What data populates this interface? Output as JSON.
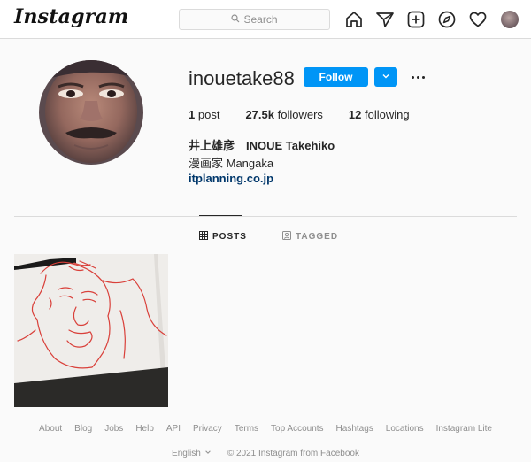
{
  "header": {
    "logo": "Instagram",
    "search_placeholder": "Search"
  },
  "profile": {
    "username": "inouetake88",
    "follow_label": "Follow",
    "stats": [
      {
        "value": "1",
        "label": "post"
      },
      {
        "value": "27.5k",
        "label": "followers"
      },
      {
        "value": "12",
        "label": "following"
      }
    ],
    "full_name": "井上雄彦　INOUE Takehiko",
    "bio": "漫画家 Mangaka",
    "link": "itplanning.co.jp"
  },
  "tabs": [
    {
      "label": "POSTS",
      "active": true
    },
    {
      "label": "TAGGED",
      "active": false
    }
  ],
  "footer": {
    "links": [
      "About",
      "Blog",
      "Jobs",
      "Help",
      "API",
      "Privacy",
      "Terms",
      "Top Accounts",
      "Hashtags",
      "Locations",
      "Instagram Lite"
    ],
    "language": "English",
    "copyright": "© 2021 Instagram from Facebook"
  },
  "colors": {
    "accent": "#0095f6",
    "link": "#00376b",
    "muted": "#8e8e8e",
    "border": "#dbdbdb"
  },
  "icons": [
    "search-icon",
    "home-icon",
    "direct-icon",
    "new-post-icon",
    "explore-icon",
    "heart-icon",
    "chevron-down-icon",
    "grid-icon",
    "tagged-icon"
  ]
}
